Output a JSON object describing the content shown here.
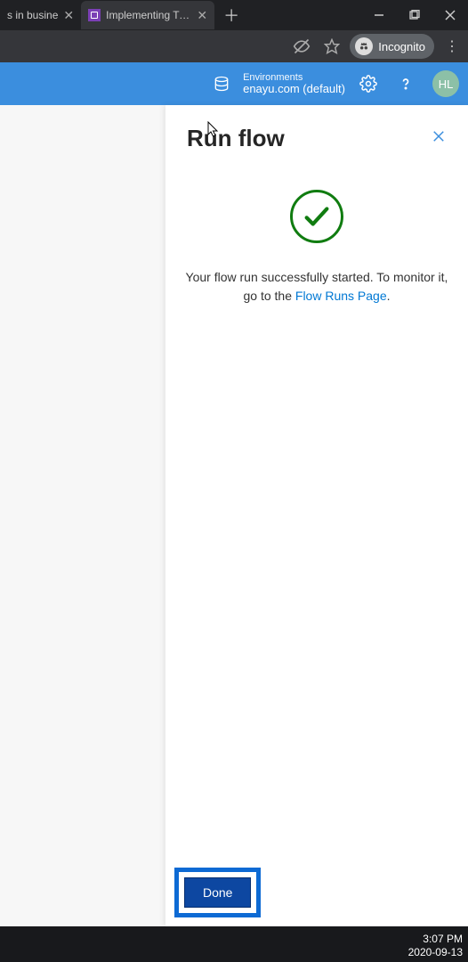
{
  "browser": {
    "tabs": [
      {
        "title_suffix": "s in busine"
      },
      {
        "title": "Implementing Try,Catch and"
      }
    ],
    "incognito_label": "Incognito"
  },
  "appbar": {
    "env_label": "Environments",
    "env_name": "enayu.com (default)",
    "avatar_initials": "HL"
  },
  "panel": {
    "title": "Run flow",
    "message_prefix": "Your flow run successfully started. To monitor it, go to the ",
    "link_text": "Flow Runs Page",
    "message_suffix": ".",
    "done_label": "Done"
  },
  "taskbar": {
    "time": "3:07 PM",
    "date": "2020-09-13"
  }
}
